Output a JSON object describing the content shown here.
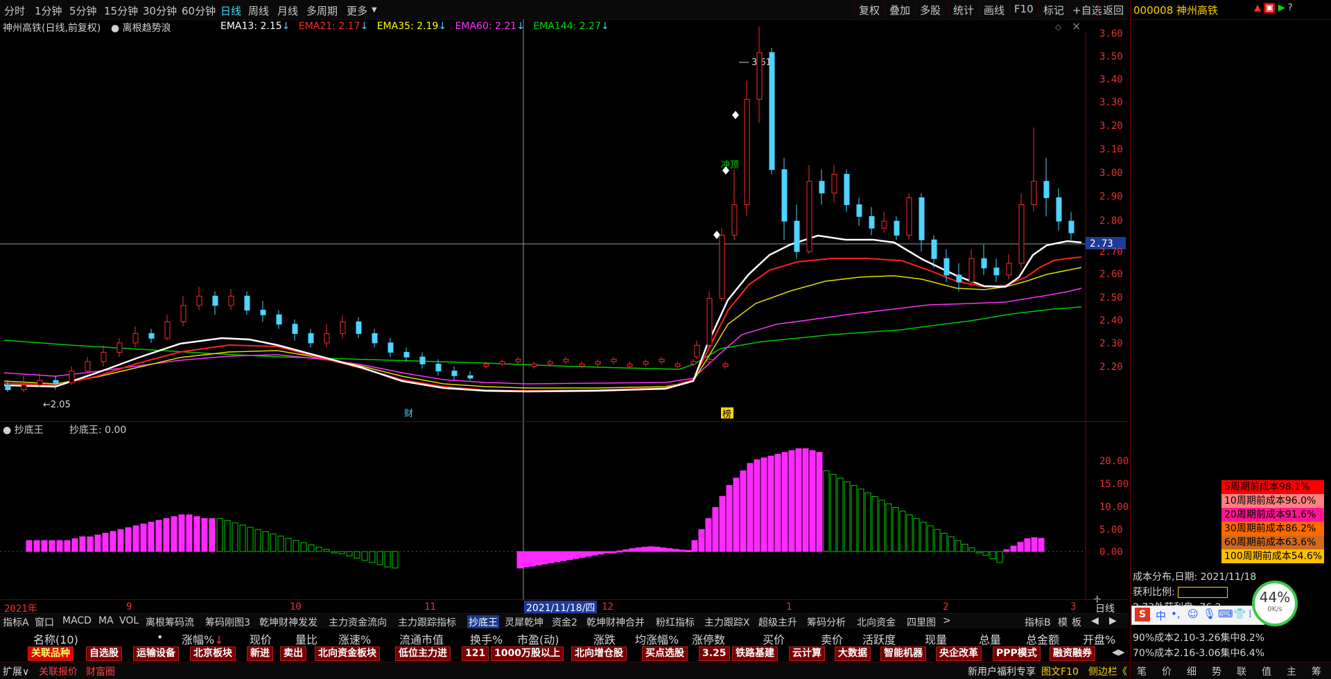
{
  "toolbar": {
    "periods": [
      "分时",
      "1分钟",
      "5分钟",
      "15分钟",
      "30分钟",
      "60分钟",
      "日线",
      "周线",
      "月线",
      "多周期",
      "更多"
    ],
    "active_period": "日线",
    "actions": [
      "复权",
      "叠加",
      "多股",
      "统计",
      "画线",
      "F10",
      "标记",
      "+自选",
      "返回"
    ]
  },
  "stock": {
    "code_name": "000008 神州高铁",
    "title": "神州高铁(日线,前复权)",
    "indicator_name": "离根趋势浪"
  },
  "ema": [
    {
      "label": "EMA13: 2.15",
      "arrow": "↓",
      "color": "#ffffff"
    },
    {
      "label": "EMA21: 2.17",
      "arrow": "↓",
      "color": "#ff2a2a"
    },
    {
      "label": "EMA35: 2.19",
      "arrow": "↓",
      "color": "#ffff00"
    },
    {
      "label": "EMA60: 2.21",
      "arrow": "↓",
      "color": "#ff33ff"
    },
    {
      "label": "EMA144: 2.27",
      "arrow": "↓",
      "color": "#00dd00"
    }
  ],
  "price_axis": [
    "3.60",
    "3.50",
    "3.40",
    "3.30",
    "3.20",
    "3.10",
    "3.00",
    "2.90",
    "2.80",
    "2.70",
    "2.60",
    "2.50",
    "2.40",
    "2.30",
    "2.20"
  ],
  "current_price_label": "2.73",
  "annotations": {
    "high": "3.61",
    "low": "←2.05",
    "signal": "冲顶",
    "marker_cai": "财",
    "marker_bang": "榜"
  },
  "sub_indicator": {
    "name": "抄底王",
    "value_label": "抄底王: 0.00",
    "axis": [
      "20.00",
      "15.00",
      "10.00",
      "5.00",
      "0.00"
    ]
  },
  "date_axis": {
    "labels": [
      "2021年",
      "9",
      "10",
      "11",
      "12",
      "1",
      "2",
      "3"
    ],
    "cursor_date": "2021/11/18/四",
    "period": "日线"
  },
  "indicator_tabs": [
    "指标A",
    "窗口",
    "MACD",
    "MA",
    "VOL",
    "离根筹码流",
    "筹码刚图3",
    "乾坤财神发发",
    "主力资金流向",
    "主力跟踪指标",
    "抄底王",
    "灵犀乾坤",
    "资金2",
    "乾坤财神合并",
    "粉红指标",
    "主力跟踪X",
    "超级主升",
    "筹码分析",
    "北向资金",
    "四里图"
  ],
  "active_indicator_tab": "抄底王",
  "indicator_tabs_right": [
    "指标B",
    "模",
    "板"
  ],
  "columns": [
    "名称(10)",
    "•",
    "涨幅%",
    "现价",
    "量比",
    "涨速%",
    "流通市值",
    "换手%",
    "市盈(动)",
    "涨跌",
    "均涨幅%",
    "涨停数",
    "买价",
    "卖价",
    "活跃度",
    "现量",
    "总量",
    "总金额",
    "开盘%"
  ],
  "sectors": [
    "关联品种",
    "自选股",
    "运输设备",
    "北京板块",
    "新进",
    "卖出",
    "北向资金板块",
    "低位主力进",
    "121",
    "1000万股以上",
    "北向增仓股",
    "买点选股",
    "3.25",
    "铁路基建",
    "云计算",
    "大数据",
    "智能机器",
    "央企改革",
    "PPP模式",
    "融资融券"
  ],
  "status_bar": {
    "left": [
      "扩展∨",
      "关联报价",
      "财富圈"
    ],
    "right": [
      "新用户福利专享",
      "图文F10",
      "侧边栏《"
    ]
  },
  "cost_legend": [
    {
      "label": "5周期前成本98.1%",
      "color": "#ff0000"
    },
    {
      "label": "10周期前成本96.0%",
      "color": "#ff8080"
    },
    {
      "label": "20周期前成本91.6%",
      "color": "#ff1493"
    },
    {
      "label": "30周期前成本86.2%",
      "color": "#ff6a00"
    },
    {
      "label": "60周期前成本63.6%",
      "color": "#d2691e"
    },
    {
      "label": "100周期前成本54.6%",
      "color": "#ffc000"
    }
  ],
  "cost_info": {
    "title": "成本分布,日期: 2021/11/18",
    "profit_label": "获利比例:",
    "profit_text": "2.73处获利盘: 76.2",
    "line1": "90%成本2.10-3.26集中8.2%",
    "line2": "70%成本2.16-3.06集中6.4%"
  },
  "speed_widget": {
    "percent": "44%",
    "rate": "0K/s"
  },
  "right_tabs": [
    "笔",
    "价",
    "细",
    "势",
    "联",
    "值",
    "主",
    "筹"
  ]
}
